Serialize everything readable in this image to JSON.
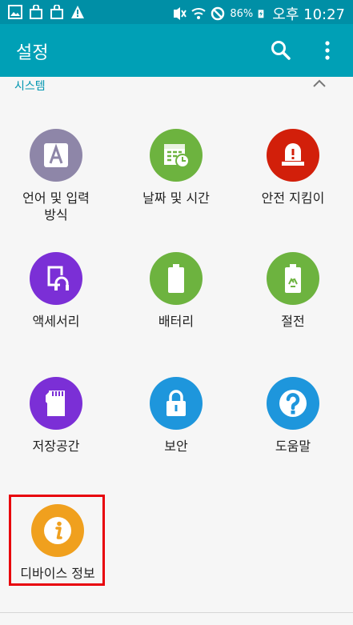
{
  "statusbar": {
    "battery_percent": "86%",
    "time": "오후 10:27",
    "left_icons": [
      "gallery-icon",
      "bag-icon",
      "bag-icon",
      "warning-icon"
    ],
    "right_icons": [
      "mute-icon",
      "wifi-icon",
      "block-icon",
      "battery-charging-icon"
    ]
  },
  "appbar": {
    "title": "설정",
    "color": "#00a0b6"
  },
  "section": {
    "label": "시스템"
  },
  "tiles": [
    {
      "label": "언어 및 입력\n방식",
      "color": "#8e86a8",
      "icon": "language-a-icon"
    },
    {
      "label": "날짜 및 시간",
      "color": "#6db33f",
      "icon": "calendar-clock-icon"
    },
    {
      "label": "안전 지킴이",
      "color": "#d21f0a",
      "icon": "siren-icon"
    },
    {
      "label": "액세서리",
      "color": "#7b2fd6",
      "icon": "accessory-icon"
    },
    {
      "label": "배터리",
      "color": "#6db33f",
      "icon": "battery-icon"
    },
    {
      "label": "절전",
      "color": "#6db33f",
      "icon": "power-saving-icon"
    },
    {
      "label": "저장공간",
      "color": "#7b2fd6",
      "icon": "sd-card-icon"
    },
    {
      "label": "보안",
      "color": "#1e96dc",
      "icon": "lock-icon"
    },
    {
      "label": "도움말",
      "color": "#1e96dc",
      "icon": "help-icon"
    },
    {
      "label": "디바이스 정보",
      "color": "#f0a01e",
      "icon": "info-icon"
    }
  ]
}
